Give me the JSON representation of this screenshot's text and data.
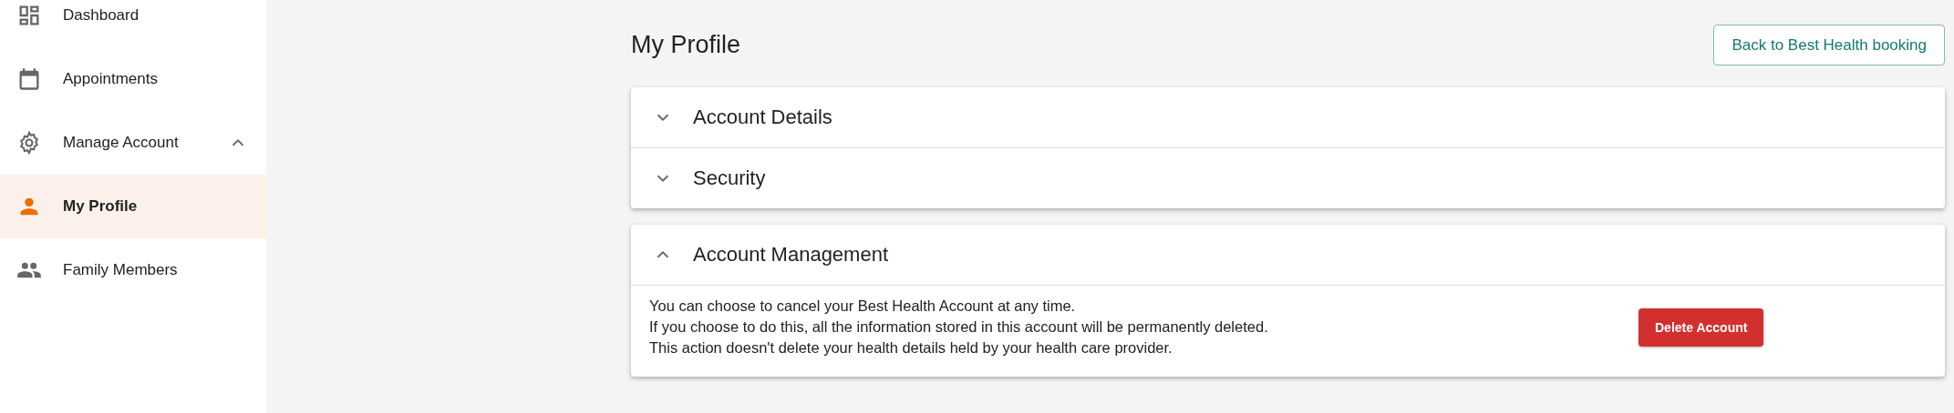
{
  "sidebar": {
    "items": [
      {
        "kind": "dashboard",
        "label": "Dashboard",
        "selected": false
      },
      {
        "kind": "calendar",
        "label": "Appointments",
        "selected": false
      },
      {
        "kind": "gear",
        "label": "Manage Account",
        "selected": false,
        "expanded": true,
        "children": [
          {
            "kind": "person",
            "label": "My Profile",
            "selected": true
          },
          {
            "kind": "people",
            "label": "Family Members",
            "selected": false
          }
        ]
      }
    ]
  },
  "header": {
    "title": "My Profile",
    "button": "Back to Best Health booking"
  },
  "panels": [
    {
      "sections": [
        {
          "title": "Account Details",
          "expanded": false
        },
        {
          "title": "Security",
          "expanded": false
        }
      ]
    },
    {
      "sections": [
        {
          "title": "Account Management",
          "expanded": true,
          "lines": [
            "You can choose to cancel your Best Health Account at any time.",
            "If you choose to do this, all the information stored in this account will be permanently deleted.",
            "This action doesn't delete your health details held by your health care provider."
          ],
          "button": "Delete Account"
        }
      ]
    }
  ]
}
